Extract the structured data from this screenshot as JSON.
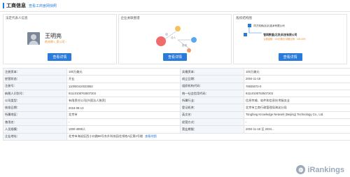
{
  "header": {
    "title": "工商信息",
    "link": "查看工商官网快照"
  },
  "panels": {
    "legal_rep": {
      "title": "法定代表人信息",
      "name": "王明亮",
      "sub": "他关联1_家公司 ›",
      "button": "查看详情"
    },
    "graph": {
      "title": "企业关联图谱",
      "button": "查看详情",
      "labels": [
        "法人",
        "投资"
      ]
    },
    "shareholders": {
      "title": "股权结构图",
      "button": "查看详情",
      "top": "同方知网(北京)技术有限公司",
      "main": "智网数据(北京)科技有限公司",
      "sub": "认缴金额：100万美元  持股比例：100.00%"
    }
  },
  "rows": [
    [
      "注册资本：",
      "100万美元",
      "实缴资本：",
      "100万美元"
    ],
    [
      "经营状态：",
      "开业",
      "成立日期：",
      "2004-11-18"
    ],
    [
      "注册号：",
      "110000410023853",
      "组织机构代码：",
      "76935072-0"
    ],
    [
      "纳税人识别号：",
      "91110108763507203",
      "统一社会信用代码：",
      "91110108763507203"
    ],
    [
      "公司类型：",
      "有限责任公司(外国法人独资)",
      "所属行业：",
      "信息传输、软件和信息技术服务业"
    ],
    [
      "核准日期：",
      "2018-08-13",
      "登记机关：",
      "北京市工商行政管理局海淀分局"
    ],
    [
      "所属地区：",
      "北京市",
      "英文名：",
      "Tongfang Knowledge Network (Beijing) Technology Co., Ltd."
    ],
    [
      "曾用名：",
      "-",
      "经营方式：",
      "-"
    ],
    [
      "人员规模：",
      "1000-4999人",
      "营业期限：",
      "2004-11-18 至 2034..."
    ]
  ],
  "address": {
    "label": "企业地址：",
    "value": "北京市海淀区西小口路66号东升科技园北领地A区第2号楼",
    "link": "查看地图"
  },
  "watermark": {
    "text": "iRankings"
  },
  "colors": {
    "accent": "#2a7bd9",
    "orange": "#e68a2e",
    "label_bg": "#f3f6fb"
  }
}
